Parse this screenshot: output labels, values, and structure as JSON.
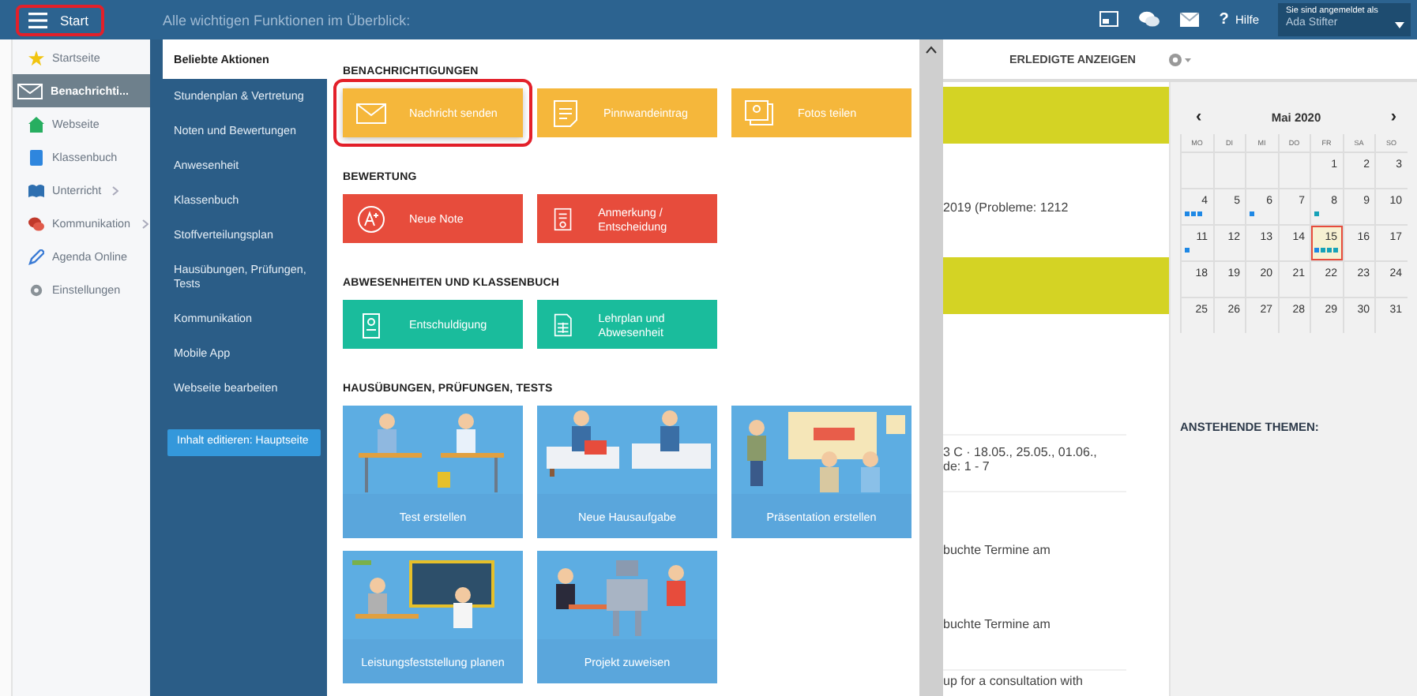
{
  "top_bar": {
    "start_button": {
      "label": "Start",
      "highlighted": true
    },
    "title": "Alle wichtigen Funktionen im Überblick:",
    "help": {
      "icon": "?",
      "label": "Hilfe"
    },
    "user": {
      "caption": "Sie sind angemeldet als",
      "name": "Ada Stifter"
    }
  },
  "sidebar": {
    "items": [
      {
        "label": "Startseite",
        "selected": false,
        "submenu": false
      },
      {
        "label": "Benachrichti...",
        "selected": true,
        "submenu": false
      },
      {
        "label": "Webseite",
        "selected": false,
        "submenu": false
      },
      {
        "label": "Klassenbuch",
        "selected": false,
        "submenu": false
      },
      {
        "label": "Unterricht",
        "selected": false,
        "submenu": true
      },
      {
        "label": "Kommunikation",
        "selected": false,
        "submenu": true
      },
      {
        "label": "Agenda Online",
        "selected": false,
        "submenu": false
      },
      {
        "label": "Einstellungen",
        "selected": false,
        "submenu": false
      }
    ]
  },
  "menu": {
    "items": [
      {
        "label": "Beliebte Aktionen",
        "selected": true
      },
      {
        "label": "Stundenplan & Vertretung",
        "selected": false
      },
      {
        "label": "Noten und Bewertungen",
        "selected": false
      },
      {
        "label": "Anwesenheit",
        "selected": false
      },
      {
        "label": "Klassenbuch",
        "selected": false
      },
      {
        "label": "Stoffverteilungsplan",
        "selected": false
      },
      {
        "label": "Hausübungen, Prüfungen, Tests",
        "selected": false
      },
      {
        "label": "Kommunikation",
        "selected": false
      },
      {
        "label": "Mobile App",
        "selected": false
      },
      {
        "label": "Webseite bearbeiten",
        "selected": false
      }
    ],
    "edit_button": "Inhalt editieren: Hauptseite"
  },
  "actions": {
    "sections": [
      {
        "title": "BENACHRICHTIGUNGEN",
        "tiles": [
          {
            "kind": "button",
            "label": "Nachricht senden",
            "color": "#f5b73b",
            "highlighted": true
          },
          {
            "kind": "button",
            "label": "Pinnwandeintrag",
            "color": "#f5b73b",
            "highlighted": false
          },
          {
            "kind": "button",
            "label": "Fotos teilen",
            "color": "#f5b73b",
            "highlighted": false
          }
        ]
      },
      {
        "title": "BEWERTUNG",
        "tiles": [
          {
            "kind": "button",
            "label": "Neue Note",
            "color": "#e74c3c",
            "highlighted": false
          },
          {
            "kind": "button",
            "label": "Anmerkung / Entscheidung",
            "color": "#e74c3c",
            "highlighted": false
          }
        ]
      },
      {
        "title": "ABWESENHEITEN UND KLASSENBUCH",
        "tiles": [
          {
            "kind": "button",
            "label": "Entschuldigung",
            "color": "#1abc9c",
            "highlighted": false
          },
          {
            "kind": "button",
            "label": "Lehrplan und Abwesenheit",
            "color": "#1abc9c",
            "highlighted": false
          }
        ]
      },
      {
        "title": "HAUSÜBUNGEN, PRÜFUNGEN, TESTS",
        "tiles": [
          {
            "kind": "picture",
            "label": "Test erstellen",
            "color": "#5dade2"
          },
          {
            "kind": "picture",
            "label": "Neue Hausaufgabe",
            "color": "#5dade2"
          },
          {
            "kind": "picture",
            "label": "Präsentation erstellen",
            "color": "#5dade2"
          },
          {
            "kind": "picture",
            "label": "Leistungsfeststellung planen",
            "color": "#5dade2"
          },
          {
            "kind": "picture",
            "label": "Projekt zuweisen",
            "color": "#5dade2"
          }
        ]
      }
    ]
  },
  "page": {
    "toolbar_button": "ERLEDIGTE ANZEIGEN",
    "lines": [
      {
        "kind": "band"
      },
      {
        "kind": "text",
        "text": "2019 (Probleme: 1212"
      },
      {
        "kind": "band"
      },
      {
        "kind": "text",
        "text": "3 C · 18.05., 25.05., 01.06.,\nde: 1 - 7"
      },
      {
        "kind": "text",
        "text": "buchte Termine am"
      },
      {
        "kind": "text",
        "text": "buchte Termine am"
      },
      {
        "kind": "text",
        "text": "up for a consultation with"
      }
    ]
  },
  "calendar": {
    "prev": "‹",
    "next": "›",
    "month": "Mai 2020",
    "weekdays": [
      "MO",
      "DI",
      "MI",
      "DO",
      "FR",
      "SA",
      "SO"
    ],
    "weeks": [
      [
        {
          "day": "1",
          "selected": false
        },
        {
          "day": "2",
          "selected": false
        },
        {
          "day": "3",
          "selected": false
        }
      ],
      [
        {
          "day": "4",
          "selected": false,
          "dots": [
            {
              "color": "#1e88e5"
            },
            {
              "color": "#1e88e5"
            },
            {
              "color": "#1e88e5"
            }
          ]
        },
        {
          "day": "5",
          "selected": false
        },
        {
          "day": "6",
          "selected": false,
          "dots": [
            {
              "color": "#1e88e5"
            }
          ]
        },
        {
          "day": "7",
          "selected": false
        },
        {
          "day": "8",
          "selected": false,
          "dots": [
            {
              "color": "#17a2b8"
            }
          ]
        },
        {
          "day": "9",
          "selected": false
        },
        {
          "day": "10",
          "selected": false
        }
      ],
      [
        {
          "day": "11",
          "selected": false,
          "dots": [
            {
              "color": "#1e88e5"
            }
          ]
        },
        {
          "day": "12",
          "selected": false
        },
        {
          "day": "13",
          "selected": false
        },
        {
          "day": "14",
          "selected": false
        },
        {
          "day": "15",
          "selected": true,
          "dots": [
            {
              "color": "#1e88e5"
            },
            {
              "color": "#17a2b8"
            },
            {
              "color": "#17a2b8"
            },
            {
              "color": "#17a2b8"
            }
          ]
        },
        {
          "day": "16",
          "selected": false
        },
        {
          "day": "17",
          "selected": false
        }
      ],
      [
        {
          "day": "18",
          "selected": false
        },
        {
          "day": "19",
          "selected": false
        },
        {
          "day": "20",
          "selected": false
        },
        {
          "day": "21",
          "selected": false
        },
        {
          "day": "22",
          "selected": false
        },
        {
          "day": "23",
          "selected": false
        },
        {
          "day": "24",
          "selected": false
        }
      ],
      [
        {
          "day": "25",
          "selected": false
        },
        {
          "day": "26",
          "selected": false
        },
        {
          "day": "27",
          "selected": false
        },
        {
          "day": "28",
          "selected": false
        },
        {
          "day": "29",
          "selected": false
        },
        {
          "day": "30",
          "selected": false
        },
        {
          "day": "31",
          "selected": false
        }
      ]
    ],
    "upcoming_title": "ANSTEHENDE THEMEN:"
  }
}
